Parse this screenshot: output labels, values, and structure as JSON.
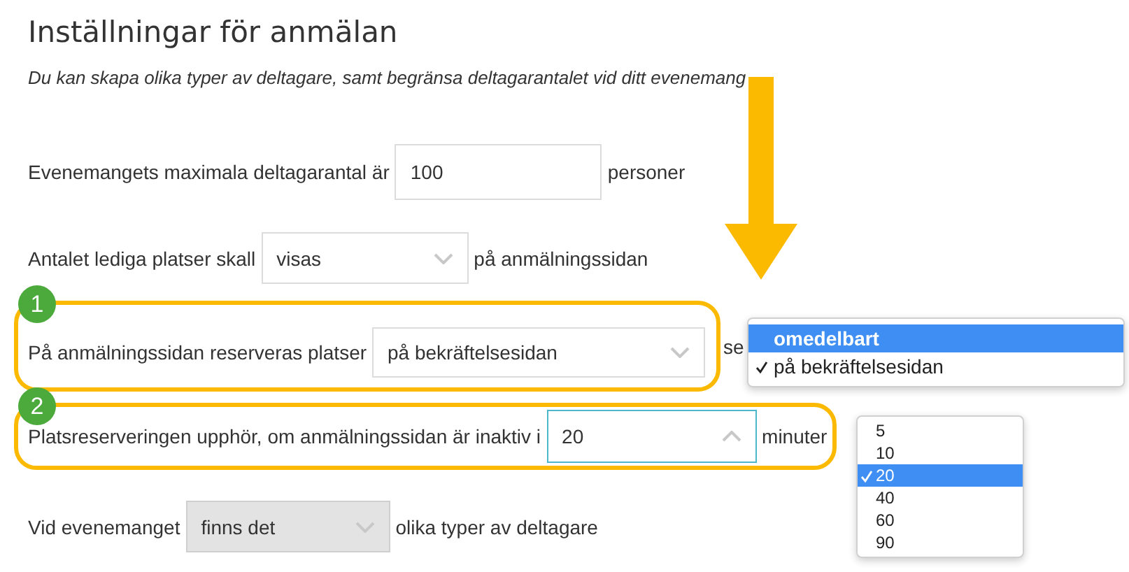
{
  "title": "Inställningar för anmälan",
  "subtitle": "Du kan skapa olika typer av deltagare, samt begränsa deltagarantalet vid ditt evenemang",
  "rows": [
    {
      "label": "Evenemangets maximala deltagarantal är",
      "control": {
        "kind": "input",
        "value": "100"
      },
      "suffix": "personer",
      "highlighted": false
    },
    {
      "label": "Antalet lediga platser skall",
      "control": {
        "kind": "select",
        "value": "visas",
        "open": false,
        "disabled": false
      },
      "suffix": "på anmälningssidan",
      "highlighted": false
    },
    {
      "label": "På anmälningssidan reserveras platser",
      "control": {
        "kind": "select",
        "value": "på bekräftelsesidan",
        "open": false,
        "disabled": false
      },
      "suffix": "se",
      "highlighted": true,
      "badge": "1"
    },
    {
      "label": "Platsreserveringen upphör, om anmälningssidan är inaktiv i",
      "control": {
        "kind": "select",
        "value": "20",
        "open": true,
        "disabled": false
      },
      "suffix": "minuter",
      "highlighted": true,
      "badge": "2"
    },
    {
      "label": "Vid evenemanget",
      "control": {
        "kind": "select",
        "value": "finns det",
        "open": false,
        "disabled": true
      },
      "suffix": "olika typer av deltagare",
      "highlighted": false
    }
  ],
  "popups": [
    {
      "options": [
        {
          "label": "omedelbart",
          "highlighted": true,
          "checked": false
        },
        {
          "label": "på bekräftelsesidan",
          "highlighted": false,
          "checked": true
        }
      ]
    },
    {
      "options": [
        {
          "label": "5",
          "highlighted": false,
          "checked": false
        },
        {
          "label": "10",
          "highlighted": false,
          "checked": false
        },
        {
          "label": "20",
          "highlighted": true,
          "checked": true
        },
        {
          "label": "40",
          "highlighted": false,
          "checked": false
        },
        {
          "label": "60",
          "highlighted": false,
          "checked": false
        },
        {
          "label": "90",
          "highlighted": false,
          "checked": false
        }
      ]
    }
  ]
}
